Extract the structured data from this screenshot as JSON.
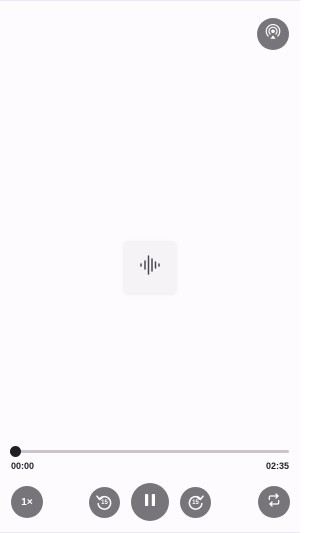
{
  "player": {
    "progress": 0.0,
    "elapsed": "00:00",
    "duration": "02:35",
    "speed_label": "1×",
    "rewind_seconds": "15",
    "forward_seconds": "15",
    "state": "playing"
  },
  "icons": {
    "cast": "cast-audio-icon",
    "artwork": "waveform-icon",
    "rewind": "rewind-15-icon",
    "pause": "pause-icon",
    "forward": "forward-15-icon",
    "repeat": "repeat-icon"
  },
  "colors": {
    "background": "#fdfbfe",
    "control": "#77757a",
    "track": "#c9c5ca",
    "progress": "#1f1f23"
  }
}
